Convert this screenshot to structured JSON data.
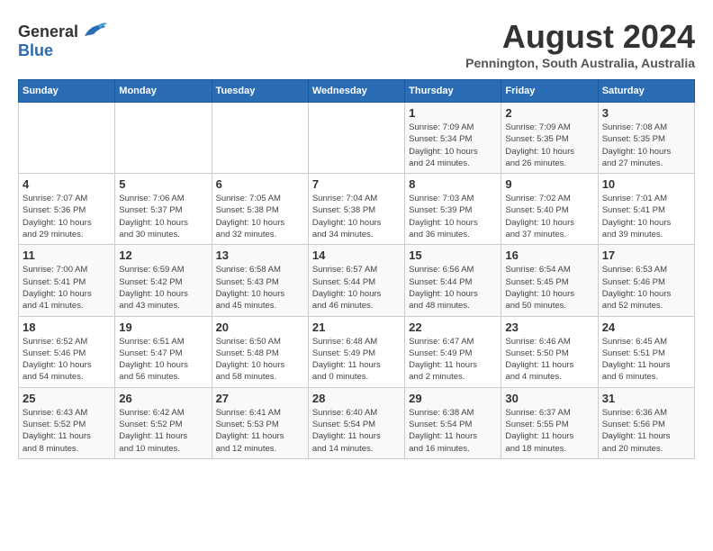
{
  "header": {
    "logo_general": "General",
    "logo_blue": "Blue",
    "month_title": "August 2024",
    "location": "Pennington, South Australia, Australia"
  },
  "days_of_week": [
    "Sunday",
    "Monday",
    "Tuesday",
    "Wednesday",
    "Thursday",
    "Friday",
    "Saturday"
  ],
  "weeks": [
    [
      {
        "day": "",
        "info": ""
      },
      {
        "day": "",
        "info": ""
      },
      {
        "day": "",
        "info": ""
      },
      {
        "day": "",
        "info": ""
      },
      {
        "day": "1",
        "info": "Sunrise: 7:09 AM\nSunset: 5:34 PM\nDaylight: 10 hours\nand 24 minutes."
      },
      {
        "day": "2",
        "info": "Sunrise: 7:09 AM\nSunset: 5:35 PM\nDaylight: 10 hours\nand 26 minutes."
      },
      {
        "day": "3",
        "info": "Sunrise: 7:08 AM\nSunset: 5:35 PM\nDaylight: 10 hours\nand 27 minutes."
      }
    ],
    [
      {
        "day": "4",
        "info": "Sunrise: 7:07 AM\nSunset: 5:36 PM\nDaylight: 10 hours\nand 29 minutes."
      },
      {
        "day": "5",
        "info": "Sunrise: 7:06 AM\nSunset: 5:37 PM\nDaylight: 10 hours\nand 30 minutes."
      },
      {
        "day": "6",
        "info": "Sunrise: 7:05 AM\nSunset: 5:38 PM\nDaylight: 10 hours\nand 32 minutes."
      },
      {
        "day": "7",
        "info": "Sunrise: 7:04 AM\nSunset: 5:38 PM\nDaylight: 10 hours\nand 34 minutes."
      },
      {
        "day": "8",
        "info": "Sunrise: 7:03 AM\nSunset: 5:39 PM\nDaylight: 10 hours\nand 36 minutes."
      },
      {
        "day": "9",
        "info": "Sunrise: 7:02 AM\nSunset: 5:40 PM\nDaylight: 10 hours\nand 37 minutes."
      },
      {
        "day": "10",
        "info": "Sunrise: 7:01 AM\nSunset: 5:41 PM\nDaylight: 10 hours\nand 39 minutes."
      }
    ],
    [
      {
        "day": "11",
        "info": "Sunrise: 7:00 AM\nSunset: 5:41 PM\nDaylight: 10 hours\nand 41 minutes."
      },
      {
        "day": "12",
        "info": "Sunrise: 6:59 AM\nSunset: 5:42 PM\nDaylight: 10 hours\nand 43 minutes."
      },
      {
        "day": "13",
        "info": "Sunrise: 6:58 AM\nSunset: 5:43 PM\nDaylight: 10 hours\nand 45 minutes."
      },
      {
        "day": "14",
        "info": "Sunrise: 6:57 AM\nSunset: 5:44 PM\nDaylight: 10 hours\nand 46 minutes."
      },
      {
        "day": "15",
        "info": "Sunrise: 6:56 AM\nSunset: 5:44 PM\nDaylight: 10 hours\nand 48 minutes."
      },
      {
        "day": "16",
        "info": "Sunrise: 6:54 AM\nSunset: 5:45 PM\nDaylight: 10 hours\nand 50 minutes."
      },
      {
        "day": "17",
        "info": "Sunrise: 6:53 AM\nSunset: 5:46 PM\nDaylight: 10 hours\nand 52 minutes."
      }
    ],
    [
      {
        "day": "18",
        "info": "Sunrise: 6:52 AM\nSunset: 5:46 PM\nDaylight: 10 hours\nand 54 minutes."
      },
      {
        "day": "19",
        "info": "Sunrise: 6:51 AM\nSunset: 5:47 PM\nDaylight: 10 hours\nand 56 minutes."
      },
      {
        "day": "20",
        "info": "Sunrise: 6:50 AM\nSunset: 5:48 PM\nDaylight: 10 hours\nand 58 minutes."
      },
      {
        "day": "21",
        "info": "Sunrise: 6:48 AM\nSunset: 5:49 PM\nDaylight: 11 hours\nand 0 minutes."
      },
      {
        "day": "22",
        "info": "Sunrise: 6:47 AM\nSunset: 5:49 PM\nDaylight: 11 hours\nand 2 minutes."
      },
      {
        "day": "23",
        "info": "Sunrise: 6:46 AM\nSunset: 5:50 PM\nDaylight: 11 hours\nand 4 minutes."
      },
      {
        "day": "24",
        "info": "Sunrise: 6:45 AM\nSunset: 5:51 PM\nDaylight: 11 hours\nand 6 minutes."
      }
    ],
    [
      {
        "day": "25",
        "info": "Sunrise: 6:43 AM\nSunset: 5:52 PM\nDaylight: 11 hours\nand 8 minutes."
      },
      {
        "day": "26",
        "info": "Sunrise: 6:42 AM\nSunset: 5:52 PM\nDaylight: 11 hours\nand 10 minutes."
      },
      {
        "day": "27",
        "info": "Sunrise: 6:41 AM\nSunset: 5:53 PM\nDaylight: 11 hours\nand 12 minutes."
      },
      {
        "day": "28",
        "info": "Sunrise: 6:40 AM\nSunset: 5:54 PM\nDaylight: 11 hours\nand 14 minutes."
      },
      {
        "day": "29",
        "info": "Sunrise: 6:38 AM\nSunset: 5:54 PM\nDaylight: 11 hours\nand 16 minutes."
      },
      {
        "day": "30",
        "info": "Sunrise: 6:37 AM\nSunset: 5:55 PM\nDaylight: 11 hours\nand 18 minutes."
      },
      {
        "day": "31",
        "info": "Sunrise: 6:36 AM\nSunset: 5:56 PM\nDaylight: 11 hours\nand 20 minutes."
      }
    ]
  ]
}
